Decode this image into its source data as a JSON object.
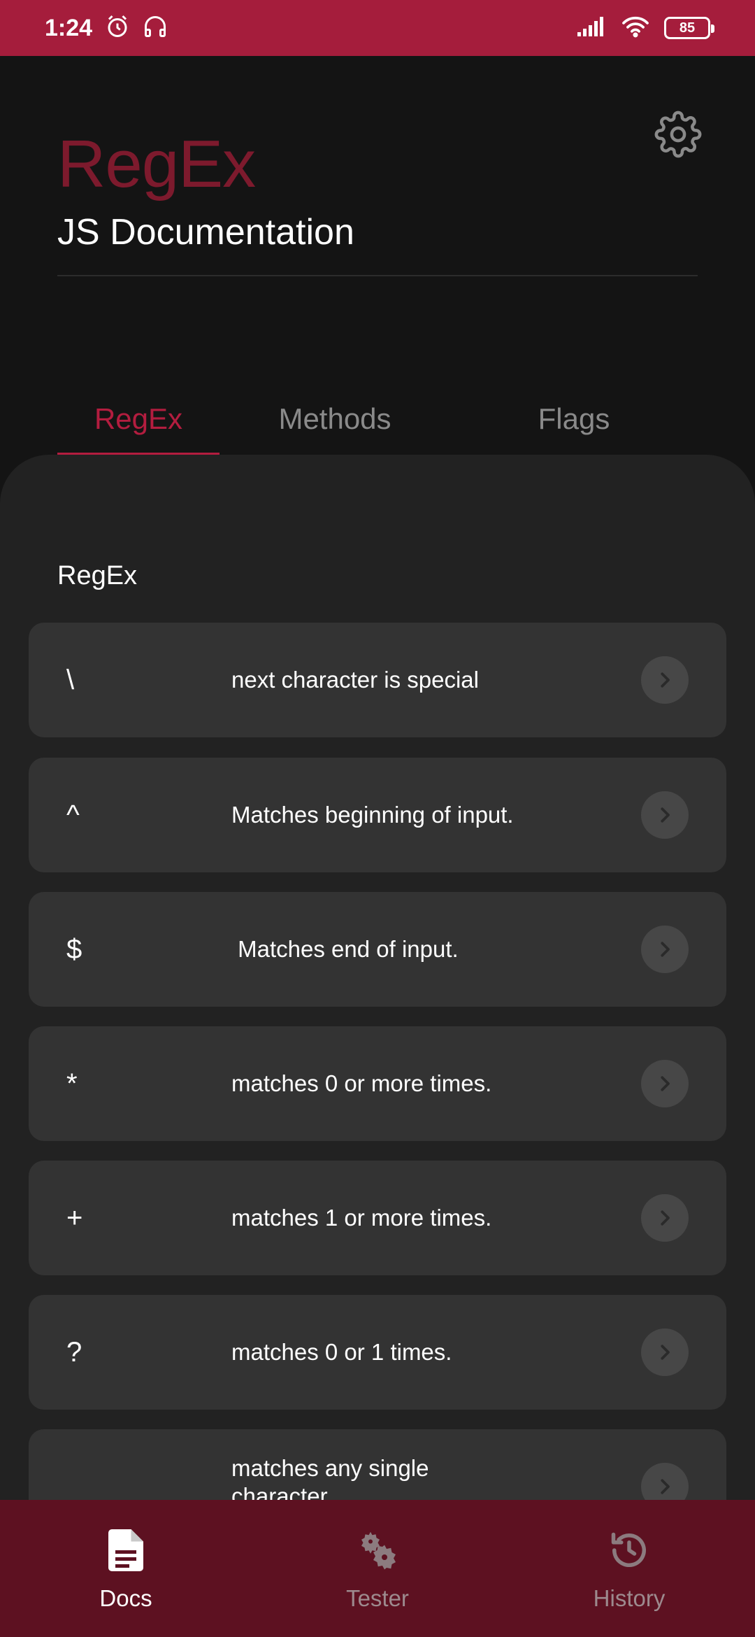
{
  "status_bar": {
    "time": "1:24",
    "battery": "85"
  },
  "header": {
    "title": "RegEx",
    "subtitle": "JS Documentation"
  },
  "tabs": [
    {
      "label": "RegEx",
      "active": true
    },
    {
      "label": "Methods",
      "active": false
    },
    {
      "label": "Flags",
      "active": false
    }
  ],
  "section": {
    "label": "RegEx"
  },
  "items": [
    {
      "symbol": "\\",
      "description": "next character is special"
    },
    {
      "symbol": "^",
      "description": "Matches beginning of input."
    },
    {
      "symbol": "$",
      "description": " Matches end of input."
    },
    {
      "symbol": "*",
      "description": "matches 0 or more times."
    },
    {
      "symbol": "+",
      "description": "matches 1 or more times."
    },
    {
      "symbol": "?",
      "description": "matches 0 or 1 times."
    },
    {
      "symbol": ".",
      "description": "matches any single character"
    }
  ],
  "bottom_nav": [
    {
      "label": "Docs",
      "icon": "document-icon",
      "active": true
    },
    {
      "label": "Tester",
      "icon": "gears-icon",
      "active": false
    },
    {
      "label": "History",
      "icon": "history-icon",
      "active": false
    }
  ],
  "colors": {
    "accent": "#b31d3f",
    "status_bar": "#a51d3c",
    "bottom_nav": "#5d1121",
    "background": "#141414",
    "card": "#333333"
  }
}
